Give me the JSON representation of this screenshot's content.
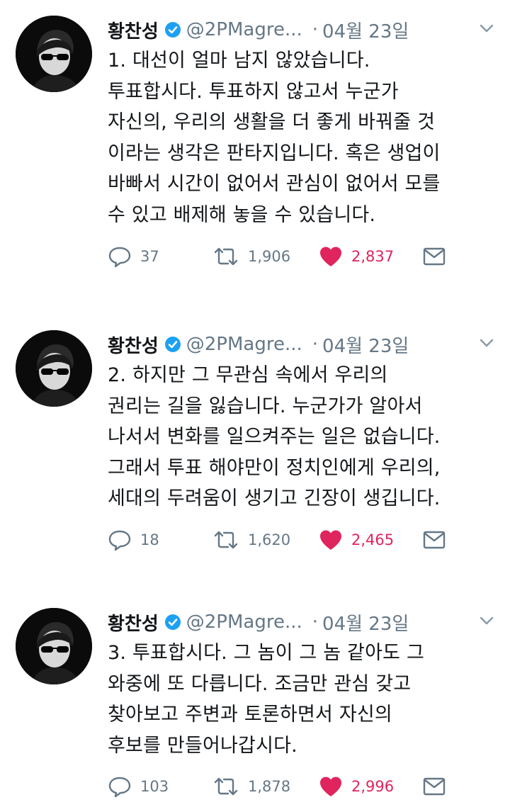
{
  "tweets": [
    {
      "name": "황찬성",
      "handle": "@2PMagre...",
      "date": "04월 23일",
      "lines": [
        "1. 대선이 얼마 남지 않았습니다.",
        "투표합시다. 투표하지 않고서 누군가",
        "자신의, 우리의 생활을 더 좋게 바꿔줄 것",
        "이라는 생각은 판타지입니다. 혹은 생업이",
        "바빠서 시간이 없어서 관심이 없어서 모를",
        "수 있고 배제해 놓을 수 있습니다."
      ],
      "replies": "37",
      "retweets": "1,906",
      "likes": "2,837"
    },
    {
      "name": "황찬성",
      "handle": "@2PMagre...",
      "date": "04월 23일",
      "lines": [
        "2. 하지만 그 무관심 속에서 우리의",
        "권리는 길을 잃습니다. 누군가가 알아서",
        "나서서 변화를 일으켜주는 일은 없습니다.",
        "그래서 투표 해야만이 정치인에게 우리의,",
        "세대의 두려움이 생기고 긴장이 생깁니다."
      ],
      "replies": "18",
      "retweets": "1,620",
      "likes": "2,465"
    },
    {
      "name": "황찬성",
      "handle": "@2PMagre...",
      "date": "04월 23일",
      "lines": [
        "3. 투표합시다. 그 놈이 그 놈 같아도 그",
        "와중에 또 다릅니다. 조금만 관심 갖고",
        "찾아보고 주변과 토론하면서 자신의",
        "후보를 만들어나갑시다."
      ],
      "replies": "103",
      "retweets": "1,878",
      "likes": "2,996"
    }
  ],
  "colors": {
    "verified": "#1da1f2",
    "like": "#e0245e",
    "muted": "#657786"
  }
}
